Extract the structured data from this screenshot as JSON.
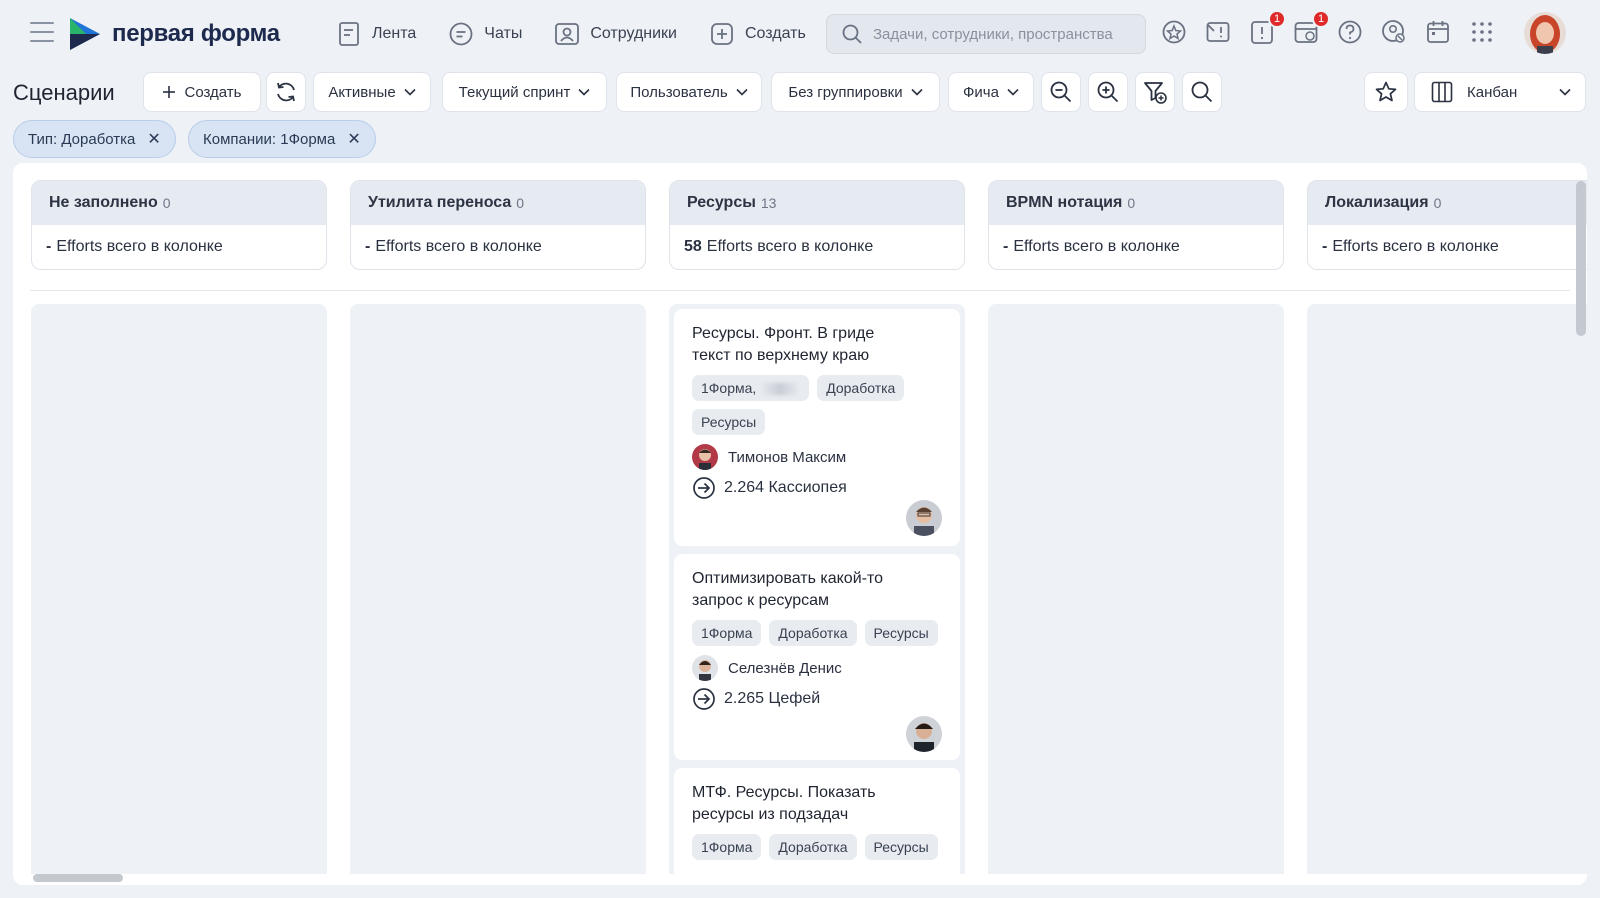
{
  "topbar": {
    "logo_text": "первая форма",
    "nav": [
      {
        "label": "Лента",
        "icon": "feed-icon"
      },
      {
        "label": "Чаты",
        "icon": "chat-icon"
      },
      {
        "label": "Сотрудники",
        "icon": "employees-icon"
      },
      {
        "label": "Создать",
        "icon": "plus-square-icon"
      }
    ],
    "search_placeholder": "Задачи, сотрудники, пространства",
    "notifications": {
      "tasks_badge": "1",
      "calendar_badge": "1"
    }
  },
  "toolbar": {
    "page_title": "Сценарии",
    "create_label": "Создать",
    "filter_active": "Активные",
    "filter_sprint": "Текущий спринт",
    "filter_user": "Пользователь",
    "filter_grouping": "Без группировки",
    "filter_feature": "Фича",
    "view_label": "Канбан"
  },
  "chips": [
    {
      "label": "Тип: Доработка"
    },
    {
      "label": "Компании: 1Форма"
    }
  ],
  "columns": [
    {
      "title": "Не заполнено",
      "count": "0",
      "efforts_value": "-",
      "efforts_label": "Efforts всего в колонке"
    },
    {
      "title": "Утилита переноса",
      "count": "0",
      "efforts_value": "-",
      "efforts_label": "Efforts всего в колонке"
    },
    {
      "title": "Ресурсы",
      "count": "13",
      "efforts_value": "58",
      "efforts_label": "Efforts всего в колонке"
    },
    {
      "title": "BPMN нотация",
      "count": "0",
      "efforts_value": "-",
      "efforts_label": "Efforts всего в колонке"
    },
    {
      "title": "Локализация",
      "count": "0",
      "efforts_value": "-",
      "efforts_label": "Efforts всего в колонке"
    }
  ],
  "cards": [
    {
      "title": "Ресурсы. Фронт. В гриде текст по верхнему краю",
      "tags": [
        "1Форма,",
        "Доработка",
        "Ресурсы"
      ],
      "person": "Тимонов Максим",
      "project": "2.264 Кассиопея"
    },
    {
      "title": "Оптимизировать какой-то запрос к ресурсам",
      "tags": [
        "1Форма",
        "Доработка",
        "Ресурсы"
      ],
      "person": "Селезнёв Денис",
      "project": "2.265 Цефей"
    },
    {
      "title": "МТФ. Ресурсы. Показать ресурсы из подзадач",
      "tags": [
        "1Форма",
        "Доработка",
        "Ресурсы"
      ]
    }
  ],
  "colors": {
    "accent": "#1d2a4d",
    "badge": "#e02a2a",
    "chip_bg": "#d8e4f4"
  }
}
